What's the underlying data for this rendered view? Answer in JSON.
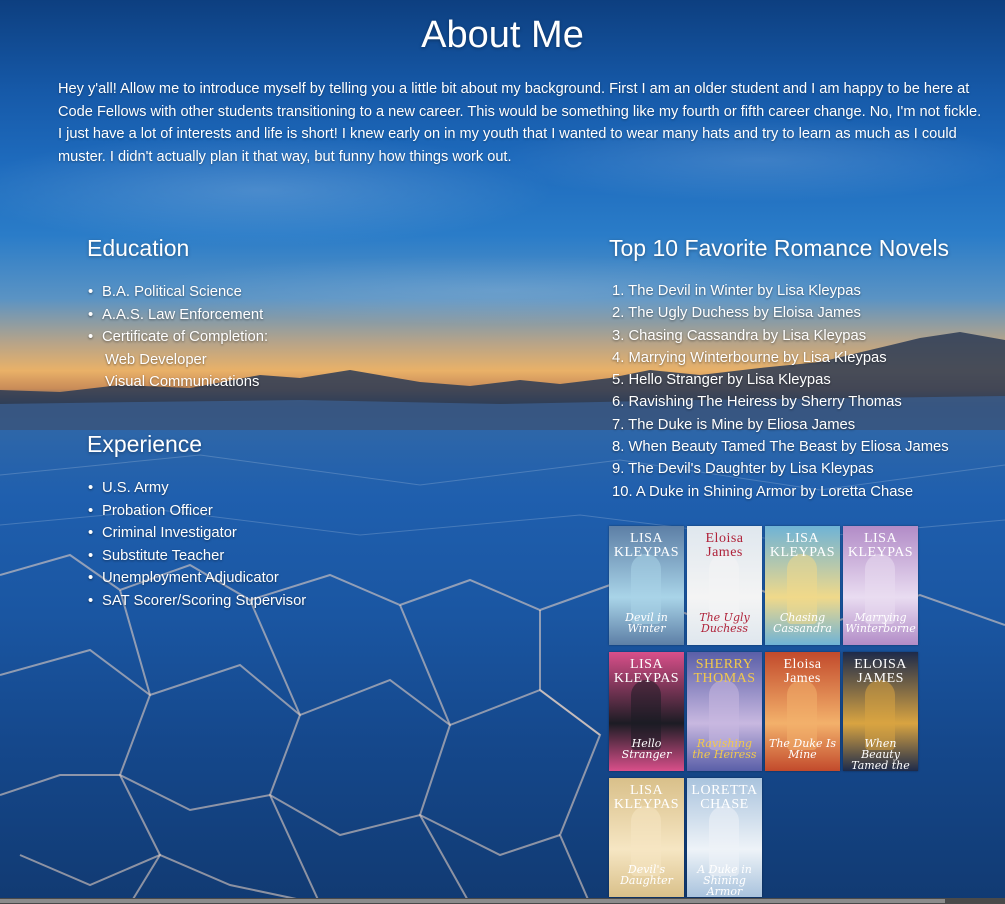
{
  "page": {
    "title": "About Me",
    "intro": "Hey y'all! Allow me to introduce myself by telling you a little bit about my background. First I am an older student and I am happy to be here at Code Fellows with other students transitioning to a new career. This would be something like my fourth or fifth career change. No, I'm not fickle. I just have a lot of interests and life is short! I knew early on in my youth that I wanted to wear many hats and try to learn as much as I could muster. I didn't actually plan it that way, but funny how things work out."
  },
  "education": {
    "heading": "Education",
    "items": [
      "B.A. Political Science",
      "A.A.S. Law Enforcement",
      "Certificate of Completion:"
    ],
    "sub_items": [
      "Web Developer",
      "Visual Communications"
    ]
  },
  "experience": {
    "heading": "Experience",
    "items": [
      "U.S. Army",
      "Probation Officer",
      "Criminal Investigator",
      "Substitute Teacher",
      "Unemployment Adjudicator",
      "SAT Scorer/Scoring Supervisor"
    ]
  },
  "novels": {
    "heading": "Top 10 Favorite Romance Novels",
    "items": [
      "1. The Devil in Winter by Lisa Kleypas",
      "2. The Ugly Duchess by Eloisa James",
      "3. Chasing Cassandra by Lisa Kleypas",
      "4. Marrying Winterbourne by Lisa Kleypas",
      "5. Hello Stranger by Lisa Kleypas",
      "6. Ravishing The Heiress by Sherry Thomas",
      "7. The Duke is Mine by Eliosa James",
      "8. When Beauty Tamed The Beast by Eliosa James",
      "9. The Devil's Daughter by Lisa Kleypas",
      "10. A Duke in Shining Armor by Loretta Chase"
    ]
  },
  "covers": [
    {
      "author": "LISA KLEYPAS",
      "title": "Devil in Winter",
      "bg": "#5d7fa6",
      "accent": "#a9d4e8",
      "text": "#ffffff"
    },
    {
      "author": "Eloisa James",
      "title": "The Ugly Duchess",
      "bg": "#dfe7ee",
      "accent": "#f4f4f4",
      "text": "#b0233a"
    },
    {
      "author": "LISA KLEYPAS",
      "title": "Chasing Cassandra",
      "bg": "#6fb3d6",
      "accent": "#f0d98a",
      "text": "#ffffff"
    },
    {
      "author": "LISA KLEYPAS",
      "title": "Marrying Winterborne",
      "bg": "#b28cc7",
      "accent": "#e9dcf1",
      "text": "#ffffff"
    },
    {
      "author": "LISA KLEYPAS",
      "title": "Hello Stranger",
      "bg": "#d94f8a",
      "accent": "#1c1c24",
      "text": "#ffffff"
    },
    {
      "author": "SHERRY THOMAS",
      "title": "Ravishing the Heiress",
      "bg": "#5a5fa8",
      "accent": "#c8b8e0",
      "text": "#f2c94c"
    },
    {
      "author": "Eloisa James",
      "title": "The Duke Is Mine",
      "bg": "#c24a2c",
      "accent": "#f3b16b",
      "text": "#ffffff"
    },
    {
      "author": "ELOISA JAMES",
      "title": "When Beauty Tamed the Beast",
      "bg": "#1d2a4a",
      "accent": "#d9a441",
      "text": "#ffffff"
    },
    {
      "author": "LISA KLEYPAS",
      "title": "Devil's Daughter",
      "bg": "#d9c08a",
      "accent": "#f6e6c3",
      "text": "#ffffff"
    },
    {
      "author": "LORETTA CHASE",
      "title": "A Duke in Shining Armor",
      "bg": "#a9c3dd",
      "accent": "#eef3f8",
      "text": "#ffffff"
    }
  ]
}
